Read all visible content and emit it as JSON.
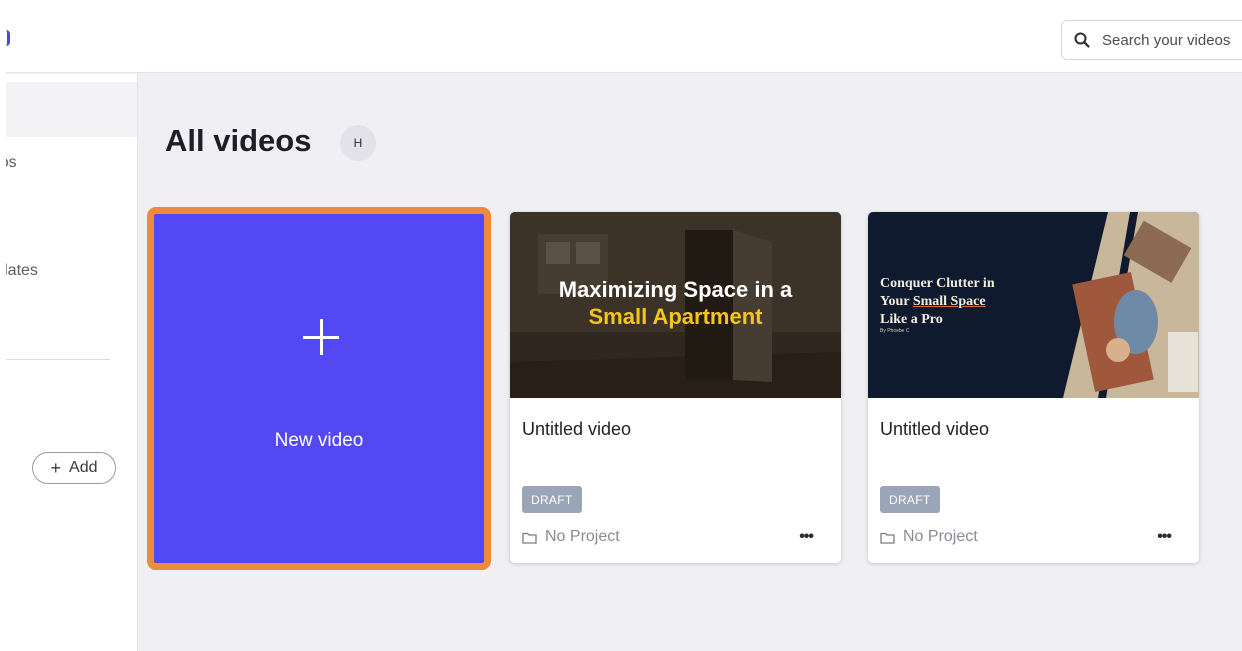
{
  "header": {
    "search_placeholder": "Search your videos"
  },
  "sidebar": {
    "items": [
      {
        "label": "Videos"
      },
      {
        "label": "Templates"
      }
    ],
    "add_label": "Add"
  },
  "main": {
    "title": "All videos",
    "avatar_initial": "H",
    "new_video_label": "New video",
    "videos": [
      {
        "title": "Untitled video",
        "status": "DRAFT",
        "project": "No Project",
        "thumbnail_line1": "Maximizing Space in a",
        "thumbnail_line2": "Small Apartment"
      },
      {
        "title": "Untitled video",
        "status": "DRAFT",
        "project": "No Project",
        "thumbnail_line1": "Conquer Clutter in",
        "thumbnail_line2a": "Your ",
        "thumbnail_line2b": "Small Space",
        "thumbnail_line3": "Like a Pro",
        "thumbnail_byline": "By Phoebe C"
      }
    ]
  },
  "colors": {
    "accent": "#5448f5",
    "selection": "#ee8a3c",
    "draft_badge": "#9aa5b8",
    "highlight_text": "#f5c518"
  }
}
